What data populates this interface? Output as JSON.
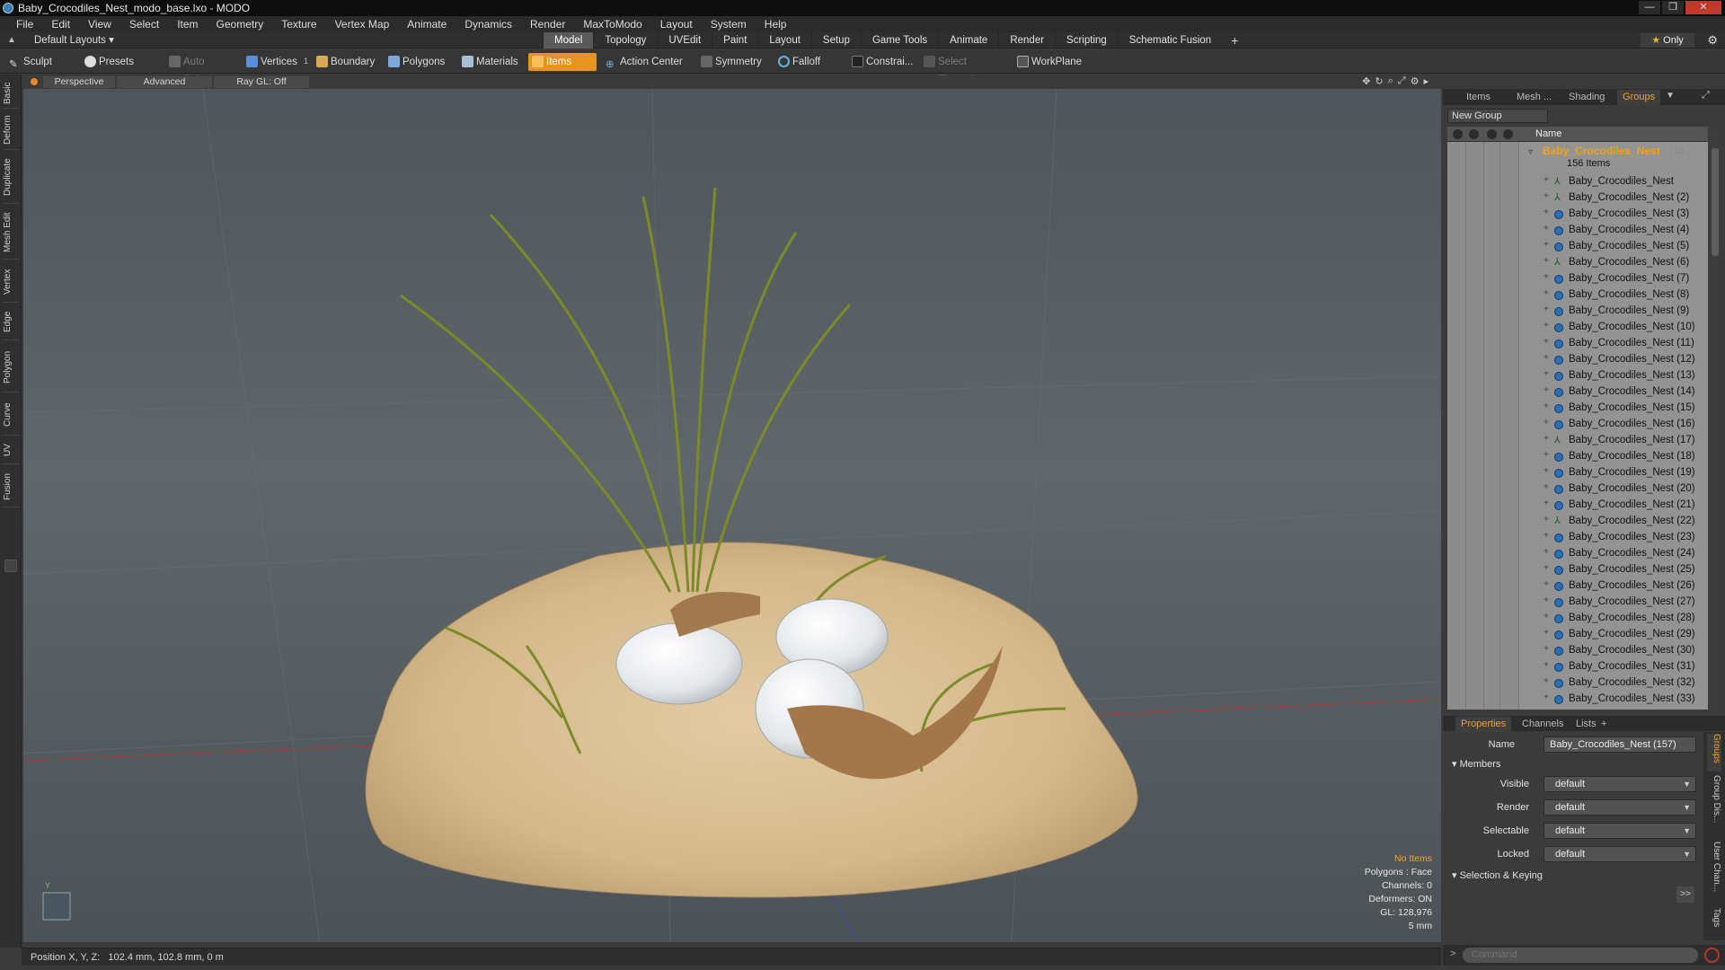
{
  "window": {
    "title": "Baby_Crocodiles_Nest_modo_base.lxo - MODO",
    "minimize": "—",
    "restore": "❐",
    "close": "✕"
  },
  "menu": [
    "File",
    "Edit",
    "View",
    "Select",
    "Item",
    "Geometry",
    "Texture",
    "Vertex Map",
    "Animate",
    "Dynamics",
    "Render",
    "MaxToModo",
    "Layout",
    "System",
    "Help"
  ],
  "layout_bar": {
    "layouts_label": "Default Layouts ▾",
    "tabs": [
      "Model",
      "Topology",
      "UVEdit",
      "Paint",
      "Layout",
      "Setup",
      "Game Tools",
      "Animate",
      "Render",
      "Scripting",
      "Schematic Fusion"
    ],
    "active_tab": "Model",
    "add": "+",
    "only": "Only"
  },
  "toolbar": {
    "sculpt": "Sculpt",
    "presets": "Presets",
    "auto_select": "Auto Select",
    "vertices": "Vertices",
    "vertices_count": "1",
    "boundary": "Boundary",
    "polygons": "Polygons",
    "materials": "Materials",
    "items": "Items",
    "action_center": "Action Center",
    "symmetry": "Symmetry",
    "falloff": "Falloff",
    "constraints": "Constrai...",
    "select_through": "Select Through",
    "workplane": "WorkPlane"
  },
  "left_tabs": [
    "Basic",
    "Deform",
    "Duplicate",
    "Mesh Edit",
    "Vertex",
    "Edge",
    "Polygon",
    "Curve",
    "UV",
    "Fusion"
  ],
  "viewport": {
    "view_mode": "Perspective",
    "shading": "Advanced",
    "raygl": "Ray GL: Off",
    "hud": {
      "no_items": "No Items",
      "polygons": "Polygons : Face",
      "channels": "Channels: 0",
      "deformers": "Deformers: ON",
      "gl": "GL: 128,976",
      "scale": "5 mm"
    },
    "axis_y": "Y"
  },
  "status": {
    "position_label": "Position X, Y, Z:",
    "position_value": "102.4 mm, 102.8 mm, 0 m"
  },
  "right_panel": {
    "tabs": [
      "Items",
      "Mesh ...",
      "Shading",
      "Groups"
    ],
    "active_tab": "Groups",
    "new_group": "New Group",
    "column_name": "Name",
    "group_name": "Baby_Crocodiles_Nest",
    "group_count_suffix": "(15 ...",
    "group_items": "156 Items",
    "items": [
      {
        "label": "Baby_Crocodiles_Nest",
        "icon": "locator-icon"
      },
      {
        "label": "Baby_Crocodiles_Nest (2)",
        "icon": "locator-icon"
      },
      {
        "label": "Baby_Crocodiles_Nest (3)",
        "icon": "mesh-icon"
      },
      {
        "label": "Baby_Crocodiles_Nest (4)",
        "icon": "mesh-icon"
      },
      {
        "label": "Baby_Crocodiles_Nest (5)",
        "icon": "mesh-icon"
      },
      {
        "label": "Baby_Crocodiles_Nest (6)",
        "icon": "locator-icon"
      },
      {
        "label": "Baby_Crocodiles_Nest (7)",
        "icon": "mesh-icon"
      },
      {
        "label": "Baby_Crocodiles_Nest (8)",
        "icon": "mesh-icon"
      },
      {
        "label": "Baby_Crocodiles_Nest (9)",
        "icon": "mesh-icon"
      },
      {
        "label": "Baby_Crocodiles_Nest (10)",
        "icon": "mesh-icon"
      },
      {
        "label": "Baby_Crocodiles_Nest (11)",
        "icon": "mesh-icon"
      },
      {
        "label": "Baby_Crocodiles_Nest (12)",
        "icon": "mesh-icon"
      },
      {
        "label": "Baby_Crocodiles_Nest (13)",
        "icon": "mesh-icon"
      },
      {
        "label": "Baby_Crocodiles_Nest (14)",
        "icon": "mesh-icon"
      },
      {
        "label": "Baby_Crocodiles_Nest (15)",
        "icon": "mesh-icon"
      },
      {
        "label": "Baby_Crocodiles_Nest (16)",
        "icon": "mesh-icon"
      },
      {
        "label": "Baby_Crocodiles_Nest (17)",
        "icon": "locator-icon"
      },
      {
        "label": "Baby_Crocodiles_Nest (18)",
        "icon": "mesh-icon"
      },
      {
        "label": "Baby_Crocodiles_Nest (19)",
        "icon": "mesh-icon"
      },
      {
        "label": "Baby_Crocodiles_Nest (20)",
        "icon": "mesh-icon"
      },
      {
        "label": "Baby_Crocodiles_Nest (21)",
        "icon": "mesh-icon"
      },
      {
        "label": "Baby_Crocodiles_Nest (22)",
        "icon": "locator-icon"
      },
      {
        "label": "Baby_Crocodiles_Nest (23)",
        "icon": "mesh-icon"
      },
      {
        "label": "Baby_Crocodiles_Nest (24)",
        "icon": "mesh-icon"
      },
      {
        "label": "Baby_Crocodiles_Nest (25)",
        "icon": "mesh-icon"
      },
      {
        "label": "Baby_Crocodiles_Nest (26)",
        "icon": "mesh-icon"
      },
      {
        "label": "Baby_Crocodiles_Nest (27)",
        "icon": "mesh-icon"
      },
      {
        "label": "Baby_Crocodiles_Nest (28)",
        "icon": "mesh-icon"
      },
      {
        "label": "Baby_Crocodiles_Nest (29)",
        "icon": "mesh-icon"
      },
      {
        "label": "Baby_Crocodiles_Nest (30)",
        "icon": "mesh-icon"
      },
      {
        "label": "Baby_Crocodiles_Nest (31)",
        "icon": "mesh-icon"
      },
      {
        "label": "Baby_Crocodiles_Nest (32)",
        "icon": "mesh-icon"
      },
      {
        "label": "Baby_Crocodiles_Nest (33)",
        "icon": "mesh-icon"
      }
    ]
  },
  "properties": {
    "tabs": [
      "Properties",
      "Channels",
      "Lists",
      "+"
    ],
    "active_tab": "Properties",
    "name_label": "Name",
    "name_value": "Baby_Crocodiles_Nest (157)",
    "members_section": "Members",
    "fields": [
      {
        "label": "Visible",
        "value": "default"
      },
      {
        "label": "Render",
        "value": "default"
      },
      {
        "label": "Selectable",
        "value": "default"
      },
      {
        "label": "Locked",
        "value": "default"
      }
    ],
    "keying_section": "Selection & Keying",
    "more": ">>",
    "side_tabs": [
      "Groups",
      "Group Dis...",
      "User Chan...",
      "Tags"
    ]
  },
  "command": {
    "placeholder": "Command",
    "prompt": ">"
  },
  "colors": {
    "accent_orange": "#e8931e",
    "group_orange": "#f5a010",
    "close_red": "#c0392b"
  }
}
